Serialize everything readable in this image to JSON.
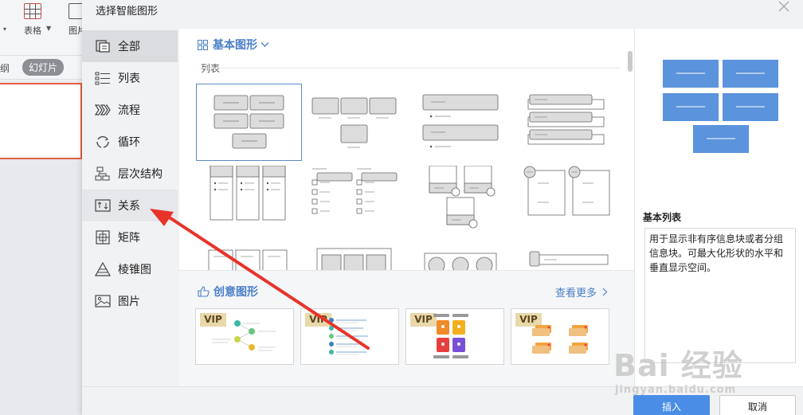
{
  "background_app": {
    "tools": [
      "表格",
      "图片"
    ],
    "tabs": {
      "outline": "纲",
      "slide": "幻灯片"
    }
  },
  "dialog": {
    "title": "选择智能图形",
    "close_icon": "close-icon"
  },
  "sidebar": {
    "items": [
      {
        "label": "全部",
        "icon": "all-icon",
        "active": true
      },
      {
        "label": "列表",
        "icon": "list-icon"
      },
      {
        "label": "流程",
        "icon": "process-icon"
      },
      {
        "label": "循环",
        "icon": "cycle-icon"
      },
      {
        "label": "层次结构",
        "icon": "hierarchy-icon"
      },
      {
        "label": "关系",
        "icon": "relationship-icon",
        "hover": true
      },
      {
        "label": "矩阵",
        "icon": "matrix-icon"
      },
      {
        "label": "棱锥图",
        "icon": "pyramid-icon"
      },
      {
        "label": "图片",
        "icon": "picture-icon"
      }
    ]
  },
  "main": {
    "basic_shapes_label": "基本图形",
    "category_label": "列表",
    "creative_label": "创意图形",
    "see_more_label": "查看更多",
    "vip_badge": "VIP"
  },
  "preview": {
    "title": "基本列表",
    "description": "用于显示非有序信息块或者分组信息块。可最大化形状的水平和垂直显示空间。"
  },
  "footer": {
    "insert_label": "插入",
    "cancel_label": "取消"
  },
  "watermark": {
    "text": "Bai 经验",
    "url": "jingyan.baidu.com"
  },
  "colors": {
    "accent": "#4a7ec8",
    "preview_block": "#5b93dc",
    "insert_button": "#4a8de6",
    "arrow": "#e8332a"
  }
}
